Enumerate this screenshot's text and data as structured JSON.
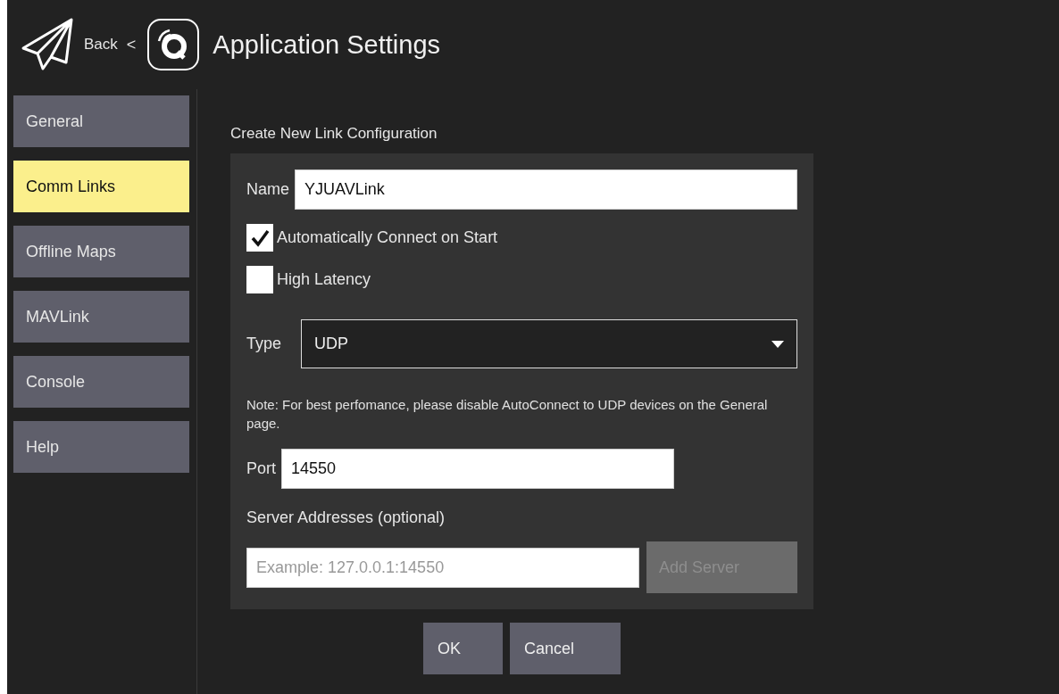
{
  "header": {
    "back_label": "Back",
    "separator": "<",
    "title": "Application Settings"
  },
  "sidebar": {
    "items": [
      {
        "label": "General",
        "selected": false
      },
      {
        "label": "Comm Links",
        "selected": true
      },
      {
        "label": "Offline Maps",
        "selected": false
      },
      {
        "label": "MAVLink",
        "selected": false
      },
      {
        "label": "Console",
        "selected": false
      },
      {
        "label": "Help",
        "selected": false
      }
    ]
  },
  "form": {
    "heading": "Create New Link Configuration",
    "name": {
      "label": "Name",
      "value": "YJUAVLink"
    },
    "checkboxes": [
      {
        "label": "Automatically Connect on Start",
        "checked": true
      },
      {
        "label": "High Latency",
        "checked": false
      }
    ],
    "type": {
      "label": "Type",
      "value": "UDP"
    },
    "note": "Note: For best perfomance, please disable AutoConnect to UDP devices on the General page.",
    "port": {
      "label": "Port",
      "value": "14550"
    },
    "servers": {
      "label": "Server Addresses (optional)",
      "placeholder": "Example: 127.0.0.1:14550",
      "add_button": {
        "label": "Add Server",
        "disabled": true
      }
    }
  },
  "buttons": [
    "OK",
    "Cancel"
  ]
}
